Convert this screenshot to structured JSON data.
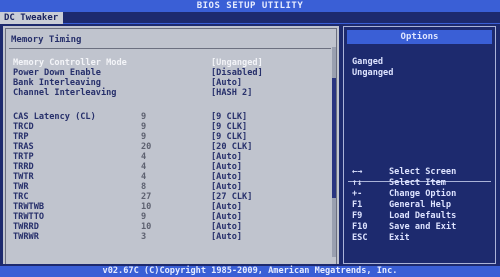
{
  "header": {
    "title": "BIOS SETUP UTILITY",
    "tab": "DC Tweaker"
  },
  "section_title": "Memory Timing",
  "rows": [
    {
      "label": "Memory Controller Mode",
      "num": "",
      "value": "[Unganged]",
      "selected": true
    },
    {
      "label": "Power Down Enable",
      "num": "",
      "value": "[Disabled]"
    },
    {
      "label": "Bank Interleaving",
      "num": "",
      "value": "[Auto]"
    },
    {
      "label": "Channel Interleaving",
      "num": "",
      "value": "[HASH 2]"
    },
    {
      "label": "",
      "num": "",
      "value": ""
    },
    {
      "label": "CAS Latency (CL)",
      "num": "9",
      "value": "[9 CLK]"
    },
    {
      "label": "TRCD",
      "num": "9",
      "value": "[9 CLK]"
    },
    {
      "label": "TRP",
      "num": "9",
      "value": "[9 CLK]"
    },
    {
      "label": "TRAS",
      "num": "20",
      "value": "[20 CLK]"
    },
    {
      "label": "TRTP",
      "num": "4",
      "value": "[Auto]"
    },
    {
      "label": "TRRD",
      "num": "4",
      "value": "[Auto]"
    },
    {
      "label": "TWTR",
      "num": "4",
      "value": "[Auto]"
    },
    {
      "label": "TWR",
      "num": "8",
      "value": "[Auto]"
    },
    {
      "label": "TRC",
      "num": "27",
      "value": "[27 CLK]"
    },
    {
      "label": "TRWTWB",
      "num": "10",
      "value": "[Auto]"
    },
    {
      "label": "TRWTTO",
      "num": "9",
      "value": "[Auto]"
    },
    {
      "label": "TWRRD",
      "num": "10",
      "value": "[Auto]"
    },
    {
      "label": "TWRWR",
      "num": "3",
      "value": "[Auto]"
    }
  ],
  "options": {
    "title": "Options",
    "items": [
      "Ganged",
      "Unganged"
    ]
  },
  "help": [
    {
      "key": "←→",
      "desc": "Select Screen"
    },
    {
      "key": "↑↓",
      "desc": "Select Item"
    },
    {
      "key": "+-",
      "desc": "Change Option"
    },
    {
      "key": "F1",
      "desc": "General Help"
    },
    {
      "key": "F9",
      "desc": "Load Defaults"
    },
    {
      "key": "F10",
      "desc": "Save and Exit"
    },
    {
      "key": "ESC",
      "desc": "Exit"
    }
  ],
  "footer": "v02.67C (C)Copyright 1985-2009, American Megatrends, Inc."
}
